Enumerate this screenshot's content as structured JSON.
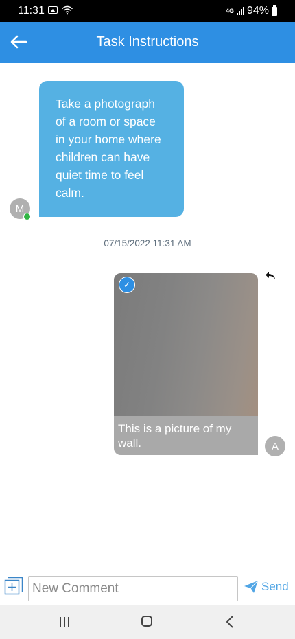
{
  "status_bar": {
    "time": "11:31",
    "network_label": "4G",
    "battery": "94%",
    "icons": [
      "gallery-icon",
      "wifi-icon",
      "signal-icon",
      "battery-icon"
    ]
  },
  "header": {
    "title": "Task Instructions",
    "back_icon": "arrow-left-icon"
  },
  "messages": [
    {
      "direction": "received",
      "avatar_initial": "M",
      "online": true,
      "text": "Take a photograph of a room or space in your home where children can have quiet time to feel calm."
    },
    {
      "direction": "sent",
      "avatar_initial": "A",
      "timestamp": "07/15/2022 11:31 AM",
      "caption": "This is a picture of my wall.",
      "selected": true
    }
  ],
  "composer": {
    "placeholder": "New Comment",
    "value": "",
    "send_label": "Send"
  },
  "nav": {
    "icons": [
      "recents-icon",
      "home-icon",
      "back-icon"
    ]
  },
  "colors": {
    "primary": "#2e8fe3",
    "received_bubble": "#55b1e3",
    "sent_bubble": "#a9a9a9",
    "online": "#32b644",
    "send": "#52a6e5"
  }
}
